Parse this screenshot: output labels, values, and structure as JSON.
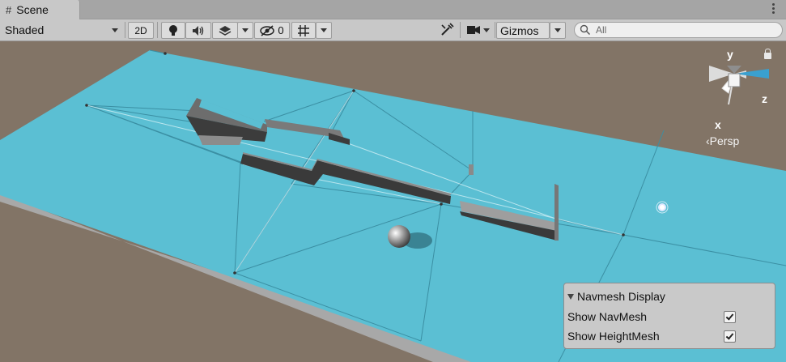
{
  "tab": {
    "title": "Scene",
    "icon": "hash-icon"
  },
  "toolbar": {
    "shading_mode": "Shaded",
    "mode_2d": "2D",
    "hidden_count": "0",
    "gizmos_label": "Gizmos",
    "search_placeholder": "All"
  },
  "orientation_gizmo": {
    "y_label": "y",
    "z_label": "z",
    "x_label": "x",
    "projection_label": "Persp"
  },
  "navmesh_panel": {
    "title": "Navmesh Display",
    "options": [
      {
        "label": "Show NavMesh",
        "checked": true
      },
      {
        "label": "Show HeightMesh",
        "checked": true
      }
    ]
  },
  "colors": {
    "navmesh": "#5bbfd3",
    "ground_background": "#827466",
    "toolbar": "#c8c8c8"
  }
}
